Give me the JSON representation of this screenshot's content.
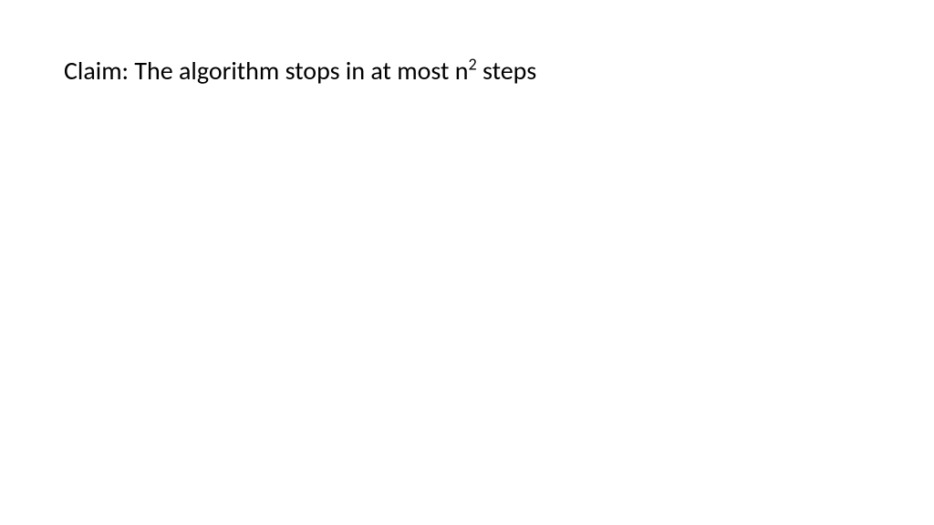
{
  "slide": {
    "claim_prefix": "Claim: The algorithm stops in at most n",
    "claim_exponent": "2",
    "claim_suffix": " steps"
  }
}
